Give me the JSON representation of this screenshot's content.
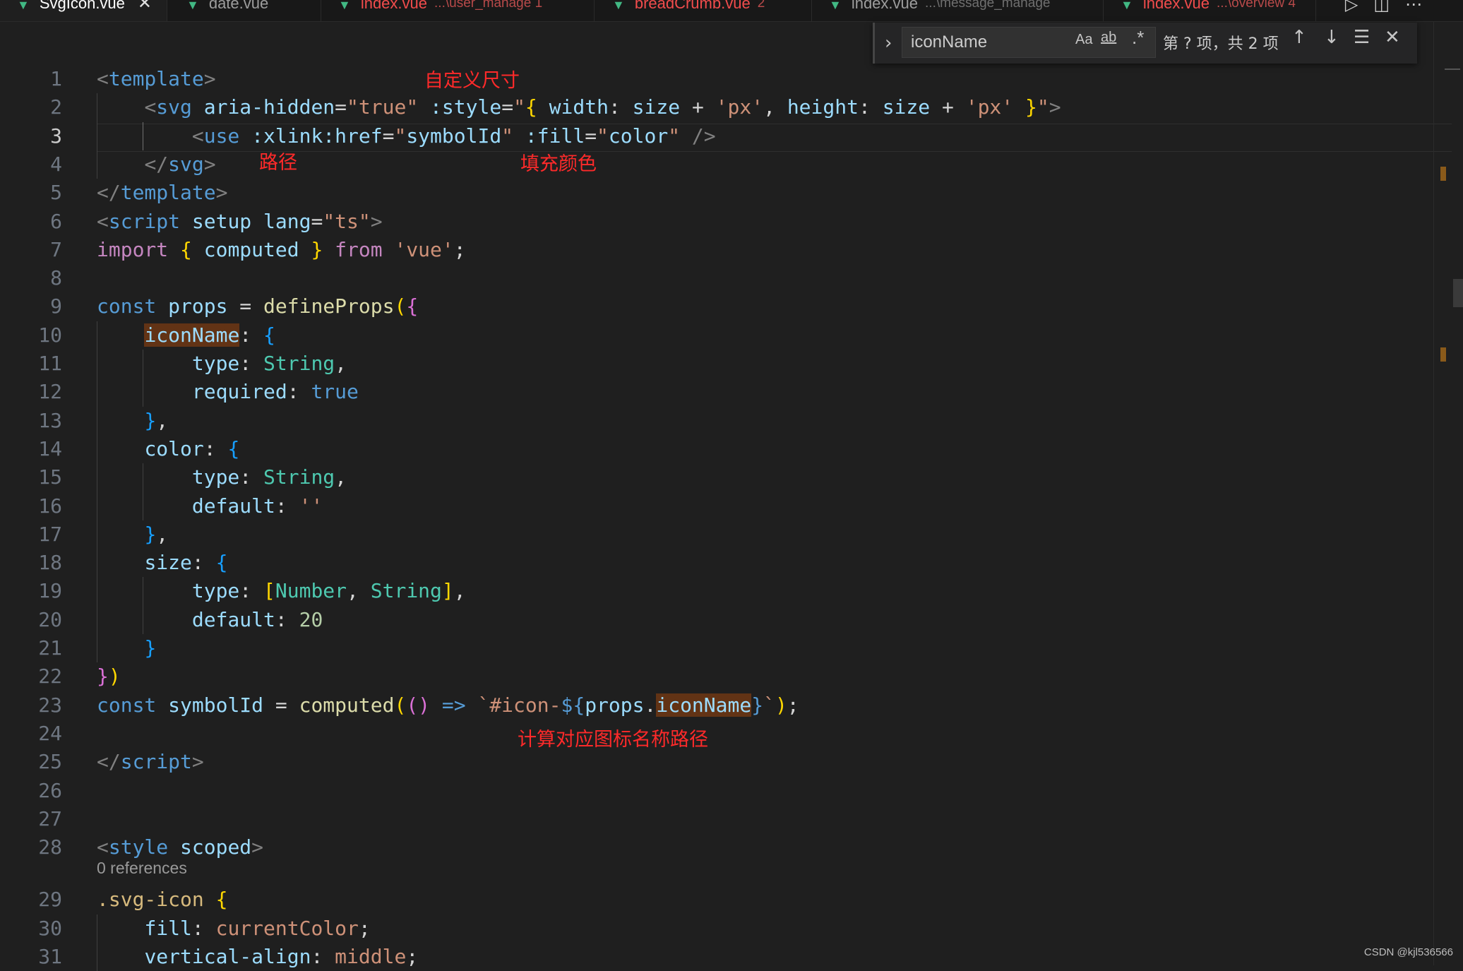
{
  "tabs": [
    {
      "label": "SvgIcon.vue",
      "path": "",
      "badge": "",
      "active": true,
      "color": "#ffffff"
    },
    {
      "label": "date.vue",
      "path": "",
      "badge": "",
      "active": false,
      "color": "#9d9d9d"
    },
    {
      "label": "index.vue",
      "path": "...\\user_manage",
      "badge": "1",
      "active": false,
      "color": "#f14c4c"
    },
    {
      "label": "breadCrumb.vue",
      "path": "",
      "badge": "2",
      "active": false,
      "color": "#f14c4c"
    },
    {
      "label": "index.vue",
      "path": "...\\message_manage",
      "badge": "",
      "active": false,
      "color": "#9d9d9d"
    },
    {
      "label": "index.vue",
      "path": "...\\overview",
      "badge": "4",
      "active": false,
      "color": "#f14c4c"
    }
  ],
  "find": {
    "value": "iconName",
    "match_case": "Aa",
    "whole_word": "ab",
    "regex": ".*",
    "count": "第 ? 项，共 2 项"
  },
  "current_line": 3,
  "codelens": "0 references",
  "annotations": {
    "size": "自定义尺寸",
    "path": "路径",
    "fill": "填充颜色",
    "computed": "计算对应图标名称路径"
  },
  "lines": [
    {
      "n": "1",
      "indent": 0,
      "tokens": [
        [
          "<",
          "tag"
        ],
        [
          "template",
          "tn"
        ],
        [
          ">",
          "tag"
        ]
      ]
    },
    {
      "n": "2",
      "indent": 1,
      "tokens": [
        [
          "<",
          "tag"
        ],
        [
          "svg",
          "tn"
        ],
        [
          " ",
          "pl"
        ],
        [
          "aria-hidden",
          "at"
        ],
        [
          "=",
          "pl"
        ],
        [
          "\"true\"",
          "str"
        ],
        [
          " ",
          "pl"
        ],
        [
          ":style",
          "at"
        ],
        [
          "=",
          "pl"
        ],
        [
          "\"",
          "str"
        ],
        [
          "{",
          "b1"
        ],
        [
          " width",
          "vr"
        ],
        [
          ": ",
          "pl"
        ],
        [
          "size",
          "vr"
        ],
        [
          " + ",
          "pl"
        ],
        [
          "'px'",
          "str"
        ],
        [
          ", ",
          "pl"
        ],
        [
          "height",
          "vr"
        ],
        [
          ": ",
          "pl"
        ],
        [
          "size",
          "vr"
        ],
        [
          " + ",
          "pl"
        ],
        [
          "'px'",
          "str"
        ],
        [
          " ",
          "pl"
        ],
        [
          "}",
          "b1"
        ],
        [
          "\"",
          "str"
        ],
        [
          ">",
          "tag"
        ]
      ]
    },
    {
      "n": "3",
      "indent": 2,
      "tokens": [
        [
          "<",
          "tag"
        ],
        [
          "use",
          "tn"
        ],
        [
          " ",
          "pl"
        ],
        [
          ":xlink:href",
          "at"
        ],
        [
          "=",
          "pl"
        ],
        [
          "\"",
          "str"
        ],
        [
          "symbolId",
          "vr"
        ],
        [
          "\"",
          "str"
        ],
        [
          " ",
          "pl"
        ],
        [
          ":fill",
          "at"
        ],
        [
          "=",
          "pl"
        ],
        [
          "\"",
          "str"
        ],
        [
          "color",
          "vr"
        ],
        [
          "\"",
          "str"
        ],
        [
          " ",
          "pl"
        ],
        [
          "/>",
          "tag"
        ]
      ]
    },
    {
      "n": "4",
      "indent": 1,
      "tokens": [
        [
          "</",
          "tag"
        ],
        [
          "svg",
          "tn"
        ],
        [
          ">",
          "tag"
        ]
      ]
    },
    {
      "n": "5",
      "indent": 0,
      "tokens": [
        [
          "</",
          "tag"
        ],
        [
          "template",
          "tn"
        ],
        [
          ">",
          "tag"
        ]
      ]
    },
    {
      "n": "6",
      "indent": 0,
      "tokens": [
        [
          "<",
          "tag"
        ],
        [
          "script",
          "tn"
        ],
        [
          " ",
          "pl"
        ],
        [
          "setup",
          "at"
        ],
        [
          " ",
          "pl"
        ],
        [
          "lang",
          "at"
        ],
        [
          "=",
          "pl"
        ],
        [
          "\"ts\"",
          "str"
        ],
        [
          ">",
          "tag"
        ]
      ]
    },
    {
      "n": "7",
      "indent": 0,
      "tokens": [
        [
          "import",
          "ctl"
        ],
        [
          " ",
          "pl"
        ],
        [
          "{",
          "b1"
        ],
        [
          " ",
          "pl"
        ],
        [
          "computed",
          "vr"
        ],
        [
          " ",
          "pl"
        ],
        [
          "}",
          "b1"
        ],
        [
          " ",
          "pl"
        ],
        [
          "from",
          "ctl"
        ],
        [
          " ",
          "pl"
        ],
        [
          "'vue'",
          "str"
        ],
        [
          ";",
          "pl"
        ]
      ]
    },
    {
      "n": "8",
      "indent": 0,
      "tokens": []
    },
    {
      "n": "9",
      "indent": 0,
      "tokens": [
        [
          "const",
          "kw"
        ],
        [
          " ",
          "pl"
        ],
        [
          "props",
          "vr"
        ],
        [
          " = ",
          "pl"
        ],
        [
          "defineProps",
          "fn"
        ],
        [
          "(",
          "b1"
        ],
        [
          "{",
          "b2"
        ]
      ]
    },
    {
      "n": "10",
      "indent": 1,
      "tokens": [
        [
          "iconName",
          "vr",
          "hl"
        ],
        [
          ": ",
          "pl"
        ],
        [
          "{",
          "b3"
        ]
      ]
    },
    {
      "n": "11",
      "indent": 2,
      "tokens": [
        [
          "type",
          "vr"
        ],
        [
          ": ",
          "pl"
        ],
        [
          "String",
          "ty"
        ],
        [
          ",",
          "pl"
        ]
      ]
    },
    {
      "n": "12",
      "indent": 2,
      "tokens": [
        [
          "required",
          "vr"
        ],
        [
          ": ",
          "pl"
        ],
        [
          "true",
          "kw"
        ]
      ]
    },
    {
      "n": "13",
      "indent": 1,
      "tokens": [
        [
          "}",
          "b3"
        ],
        [
          ",",
          "pl"
        ]
      ]
    },
    {
      "n": "14",
      "indent": 1,
      "tokens": [
        [
          "color",
          "vr"
        ],
        [
          ": ",
          "pl"
        ],
        [
          "{",
          "b3"
        ]
      ]
    },
    {
      "n": "15",
      "indent": 2,
      "tokens": [
        [
          "type",
          "vr"
        ],
        [
          ": ",
          "pl"
        ],
        [
          "String",
          "ty"
        ],
        [
          ",",
          "pl"
        ]
      ]
    },
    {
      "n": "16",
      "indent": 2,
      "tokens": [
        [
          "default",
          "vr"
        ],
        [
          ": ",
          "pl"
        ],
        [
          "''",
          "str"
        ]
      ]
    },
    {
      "n": "17",
      "indent": 1,
      "tokens": [
        [
          "}",
          "b3"
        ],
        [
          ",",
          "pl"
        ]
      ]
    },
    {
      "n": "18",
      "indent": 1,
      "tokens": [
        [
          "size",
          "vr"
        ],
        [
          ": ",
          "pl"
        ],
        [
          "{",
          "b3"
        ]
      ]
    },
    {
      "n": "19",
      "indent": 2,
      "tokens": [
        [
          "type",
          "vr"
        ],
        [
          ": ",
          "pl"
        ],
        [
          "[",
          "b1"
        ],
        [
          "Number",
          "ty"
        ],
        [
          ", ",
          "pl"
        ],
        [
          "String",
          "ty"
        ],
        [
          "]",
          "b1"
        ],
        [
          ",",
          "pl"
        ]
      ]
    },
    {
      "n": "20",
      "indent": 2,
      "tokens": [
        [
          "default",
          "vr"
        ],
        [
          ": ",
          "pl"
        ],
        [
          "20",
          "num"
        ]
      ]
    },
    {
      "n": "21",
      "indent": 1,
      "tokens": [
        [
          "}",
          "b3"
        ]
      ]
    },
    {
      "n": "22",
      "indent": 0,
      "tokens": [
        [
          "}",
          "b2"
        ],
        [
          ")",
          "b1"
        ]
      ]
    },
    {
      "n": "23",
      "indent": 0,
      "tokens": [
        [
          "const",
          "kw"
        ],
        [
          " ",
          "pl"
        ],
        [
          "symbolId",
          "vr"
        ],
        [
          " = ",
          "pl"
        ],
        [
          "computed",
          "fn"
        ],
        [
          "(",
          "b1"
        ],
        [
          "(",
          "b2"
        ],
        [
          ")",
          "b2"
        ],
        [
          " ",
          "pl"
        ],
        [
          "=>",
          "kw"
        ],
        [
          " ",
          "pl"
        ],
        [
          "`#icon-",
          "str"
        ],
        [
          "${",
          "kw"
        ],
        [
          "props",
          "vr"
        ],
        [
          ".",
          "pl"
        ],
        [
          "iconName",
          "vr",
          "hl"
        ],
        [
          "}",
          "kw"
        ],
        [
          "`",
          "str"
        ],
        [
          ")",
          "b1"
        ],
        [
          ";",
          "pl"
        ]
      ]
    },
    {
      "n": "24",
      "indent": 0,
      "tokens": []
    },
    {
      "n": "25",
      "indent": 0,
      "tokens": [
        [
          "</",
          "tag"
        ],
        [
          "script",
          "tn"
        ],
        [
          ">",
          "tag"
        ]
      ]
    },
    {
      "n": "26",
      "indent": 0,
      "tokens": []
    },
    {
      "n": "27",
      "indent": 0,
      "tokens": []
    },
    {
      "n": "28",
      "indent": 0,
      "tokens": [
        [
          "<",
          "tag"
        ],
        [
          "style",
          "tn"
        ],
        [
          " ",
          "pl"
        ],
        [
          "scoped",
          "at"
        ],
        [
          ">",
          "tag"
        ]
      ]
    },
    {
      "n": "29",
      "indent": 0,
      "tokens": [
        [
          ".svg-icon",
          "cls"
        ],
        [
          " ",
          "pl"
        ],
        [
          "{",
          "b1"
        ]
      ]
    },
    {
      "n": "30",
      "indent": 1,
      "tokens": [
        [
          "fill",
          "at"
        ],
        [
          ": ",
          "pl"
        ],
        [
          "currentColor",
          "str"
        ],
        [
          ";",
          "pl"
        ]
      ]
    },
    {
      "n": "31",
      "indent": 1,
      "tokens": [
        [
          "vertical-align",
          "at"
        ],
        [
          ": ",
          "pl"
        ],
        [
          "middle",
          "str"
        ],
        [
          ";",
          "pl"
        ]
      ]
    }
  ],
  "watermark": "CSDN @kjl536566"
}
